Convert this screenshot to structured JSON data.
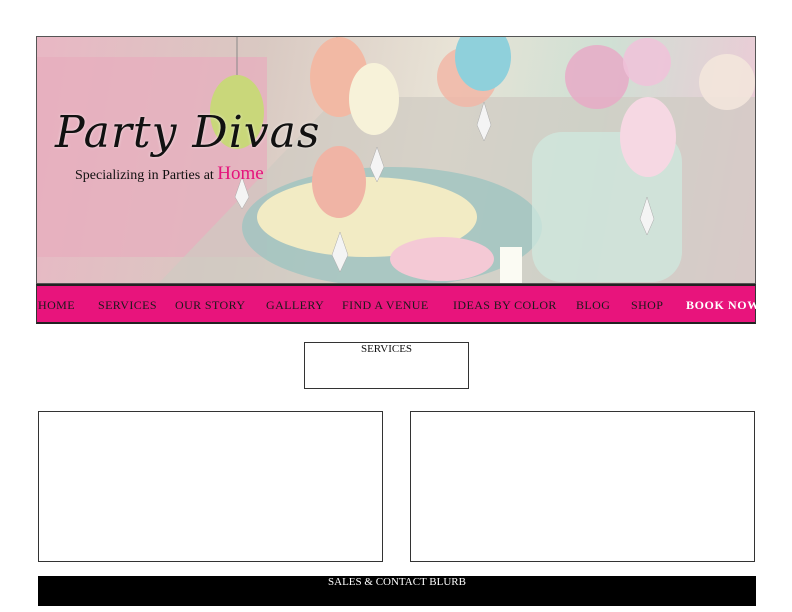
{
  "header": {
    "logo_title": "Party Divas",
    "tagline_prefix": "Specializing in Parties at",
    "tagline_accent": "Home"
  },
  "nav": {
    "items": [
      "HOME",
      "SERVICES",
      "OUR STORY",
      "GALLERY",
      "FIND A VENUE",
      "IDEAS BY COLOR",
      "BLOG",
      "SHOP"
    ],
    "book_now": "BOOK NOW"
  },
  "sections": {
    "services_label": "SERVICES"
  },
  "footer": {
    "label": "SALES & CONTACT BLURB"
  },
  "colors": {
    "brand_pink": "#e8147c",
    "tagline_accent": "#e4147c",
    "footer_bg": "#000000",
    "book_now_text": "#ffffff"
  }
}
